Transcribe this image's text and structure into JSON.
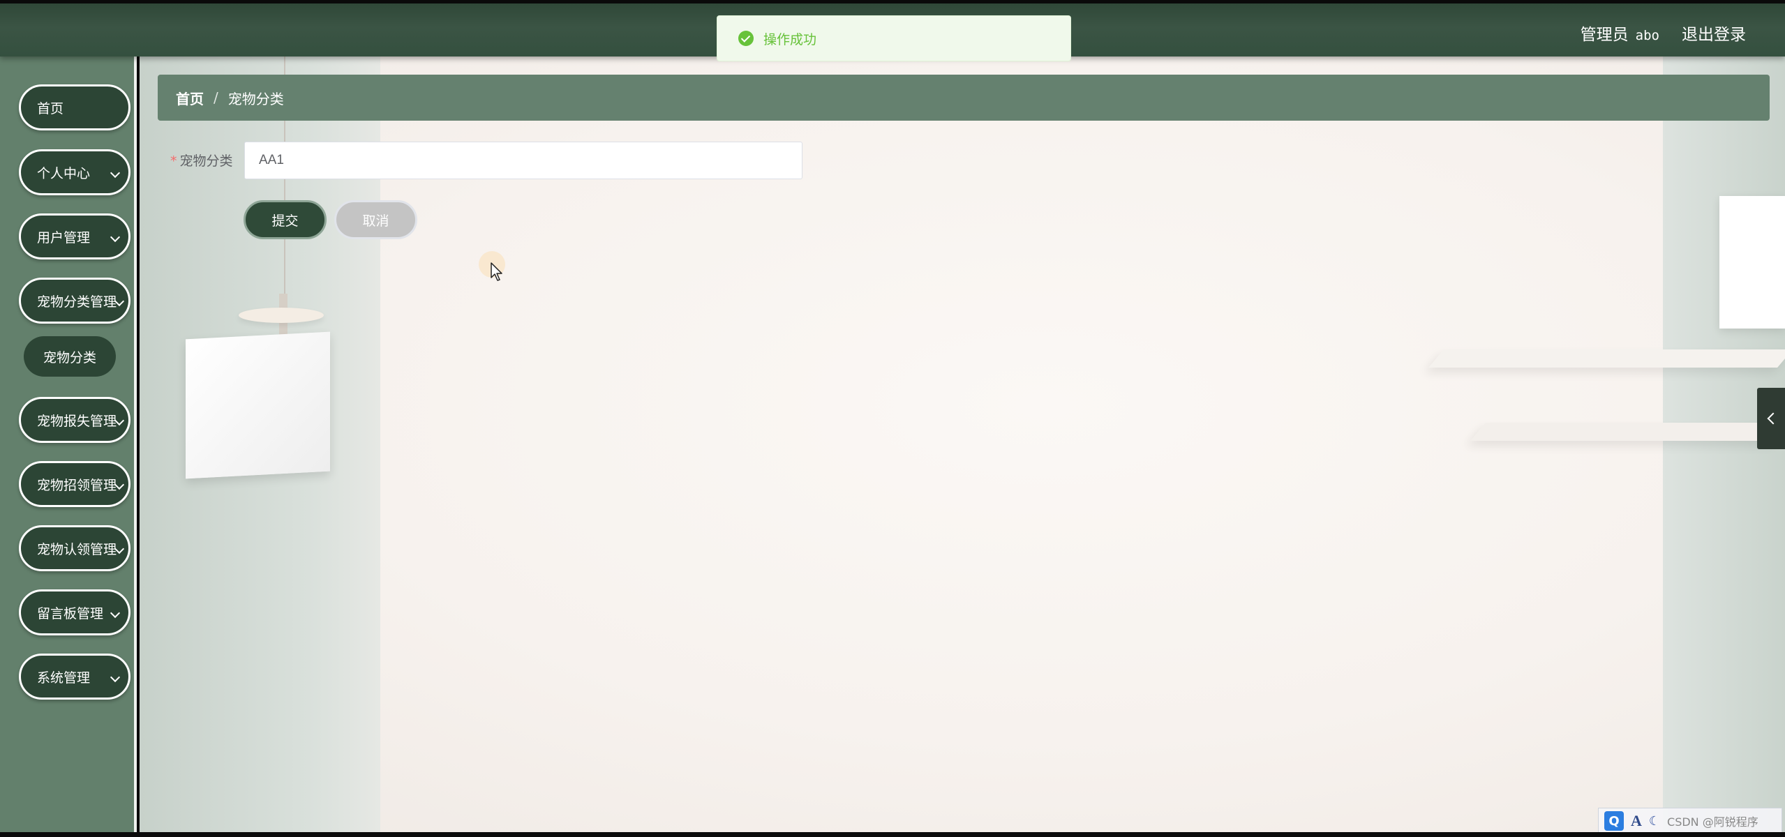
{
  "header": {
    "role_label": "管理员",
    "username": "abo",
    "logout_label": "退出登录"
  },
  "toast": {
    "message": "操作成功",
    "type": "success",
    "color": "#67c23a"
  },
  "sidebar": {
    "items": [
      {
        "label": "首页",
        "has_chevron": false
      },
      {
        "label": "个人中心",
        "has_chevron": true
      },
      {
        "label": "用户管理",
        "has_chevron": true
      },
      {
        "label": "宠物分类管理",
        "has_chevron": true,
        "expanded": true
      },
      {
        "label": "宠物报失管理",
        "has_chevron": true
      },
      {
        "label": "宠物招领管理",
        "has_chevron": true
      },
      {
        "label": "宠物认领管理",
        "has_chevron": true
      },
      {
        "label": "留言板管理",
        "has_chevron": true
      },
      {
        "label": "系统管理",
        "has_chevron": true
      }
    ],
    "sub_item": {
      "label": "宠物分类"
    }
  },
  "breadcrumb": {
    "home": "首页",
    "separator": "/",
    "current": "宠物分类"
  },
  "form": {
    "field_label": "宠物分类",
    "required_mark": "*",
    "field_value": "AA1",
    "submit_label": "提交",
    "cancel_label": "取消"
  },
  "tray": {
    "q_icon": "Q",
    "a_icon": "A",
    "watermark": "CSDN @阿锐程序"
  },
  "colors": {
    "brand_dark": "#2c4535",
    "sidebar_bg": "#63806c",
    "breadcrumb_bg": "#65816f",
    "required": "#f56c6c"
  }
}
